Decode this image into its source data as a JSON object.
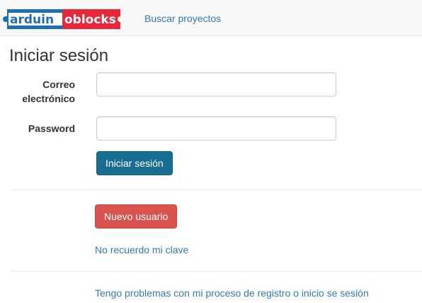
{
  "navbar": {
    "logo_text": "arduinoblocks",
    "logo_part1": "arduin",
    "logo_part2": "oblocks",
    "search_projects_label": "Buscar proyectos"
  },
  "page": {
    "title": "Iniciar sesión"
  },
  "form": {
    "email_label_line1": "Correo",
    "email_label_line2": "electrónico",
    "email_value": "",
    "password_label": "Password",
    "password_value": "",
    "login_button_label": "Iniciar sesión"
  },
  "actions": {
    "new_user_button_label": "Nuevo usuario",
    "forgot_password_link": "No recuerdo mi clave",
    "problems_link": "Tengo problemas con mi proceso de registro o inicio se sesión"
  },
  "colors": {
    "navbar_bg": "#f8f8f8",
    "link": "#337ab7",
    "primary_button": "#176e91",
    "danger_button": "#d9534f",
    "logo_blue": "#1d6fb5",
    "logo_red": "#e8283a"
  }
}
